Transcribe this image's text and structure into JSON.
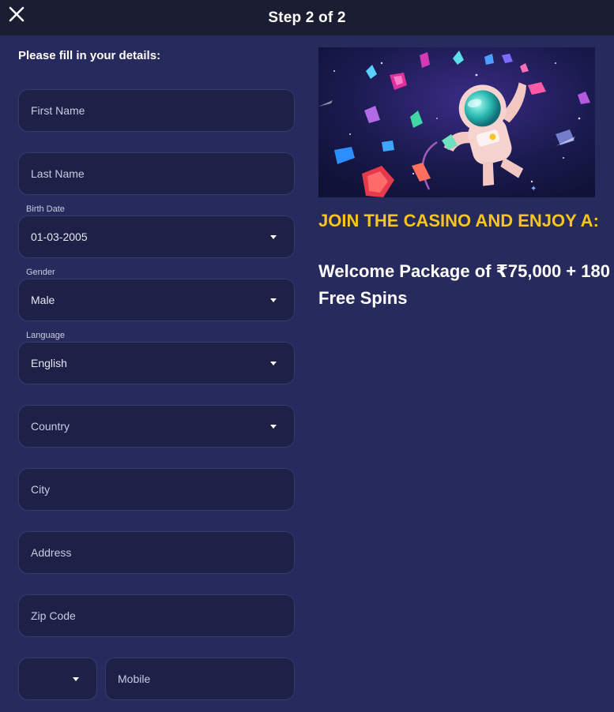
{
  "header": {
    "title": "Step 2 of 2",
    "close_icon": "close-icon"
  },
  "form": {
    "heading": "Please fill in your details:",
    "first_name": {
      "placeholder": "First Name"
    },
    "last_name": {
      "placeholder": "Last Name"
    },
    "birth_date": {
      "label": "Birth Date",
      "value": "01-03-2005"
    },
    "gender": {
      "label": "Gender",
      "value": "Male"
    },
    "language": {
      "label": "Language",
      "value": "English"
    },
    "country": {
      "placeholder": "Country"
    },
    "city": {
      "placeholder": "City"
    },
    "address": {
      "placeholder": "Address"
    },
    "zip": {
      "placeholder": "Zip Code"
    },
    "phone_code": {
      "value": ""
    },
    "mobile": {
      "placeholder": "Mobile"
    }
  },
  "promo": {
    "line1": "JOIN THE CASINO AND ENJOY A:",
    "line2": "Welcome Package of ₹75,000 + 180 Free Spins",
    "image_icon": "astronaut-space-gems-illustration"
  },
  "colors": {
    "background": "#272a5c",
    "topbar": "#1b1d33",
    "field": "#1d2147",
    "accent_yellow": "#f7c51d"
  }
}
